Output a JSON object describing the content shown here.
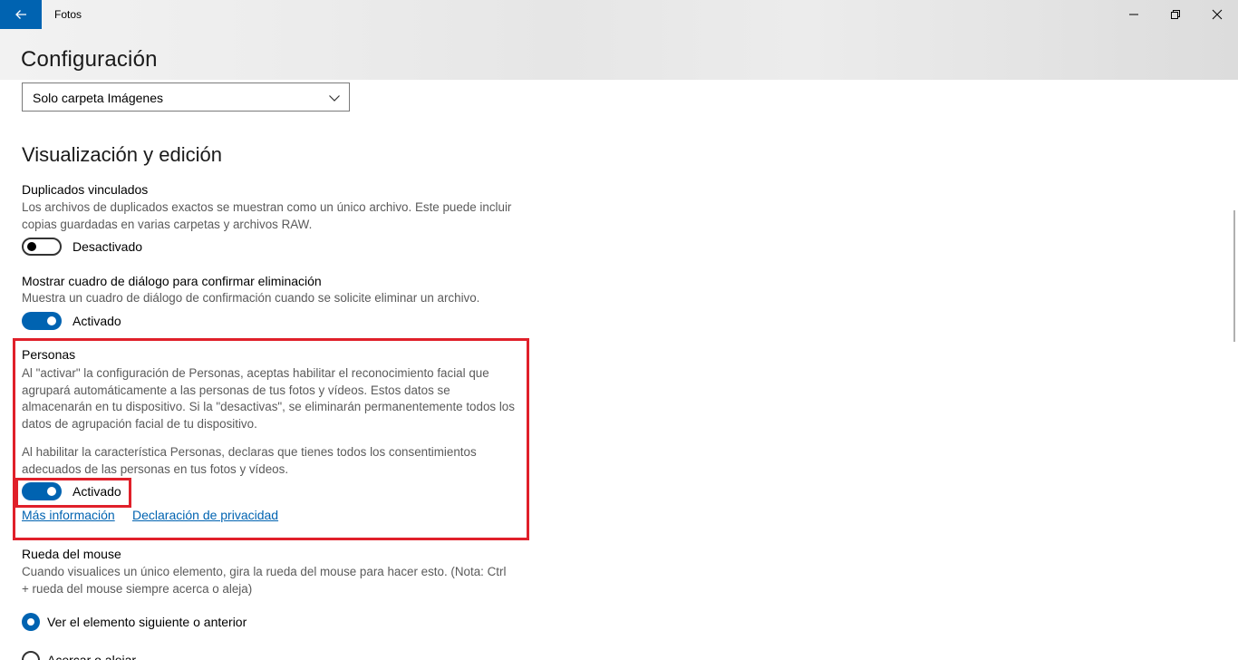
{
  "window": {
    "app_title": "Fotos",
    "page_title": "Configuración"
  },
  "source_dropdown": {
    "selected": "Solo carpeta Imágenes"
  },
  "section": {
    "title": "Visualización y edición"
  },
  "settings": {
    "duplicates": {
      "title": "Duplicados vinculados",
      "description": "Los archivos de duplicados exactos se muestran como un único archivo. Este puede incluir copias guardadas en varias carpetas y archivos RAW.",
      "state": "Desactivado",
      "on": false
    },
    "confirm_delete": {
      "title": "Mostrar cuadro de diálogo para confirmar eliminación",
      "description": "Muestra un cuadro de diálogo de confirmación cuando se solicite eliminar un archivo.",
      "state": "Activado",
      "on": true
    },
    "people": {
      "title": "Personas",
      "description1": "Al \"activar\" la configuración de Personas, aceptas habilitar el reconocimiento facial que agrupará automáticamente a las personas de tus fotos y vídeos. Estos datos se almacenarán en tu dispositivo. Si la \"desactivas\", se eliminarán permanentemente todos los datos de agrupación facial de tu dispositivo.",
      "description2": "Al habilitar la característica Personas, declaras que tienes todos los consentimientos adecuados de las personas en tus fotos y vídeos.",
      "state": "Activado",
      "on": true,
      "link_more": "Más información",
      "link_privacy": "Declaración de privacidad"
    },
    "mouse_wheel": {
      "title": "Rueda del mouse",
      "description": "Cuando visualices un único elemento, gira la rueda del mouse para hacer esto. (Nota: Ctrl + rueda del mouse siempre acerca o aleja)",
      "option1": "Ver el elemento siguiente o anterior",
      "option2": "Acercar o alejar"
    }
  },
  "colors": {
    "accent": "#0063b1",
    "highlight": "#e0202a"
  }
}
